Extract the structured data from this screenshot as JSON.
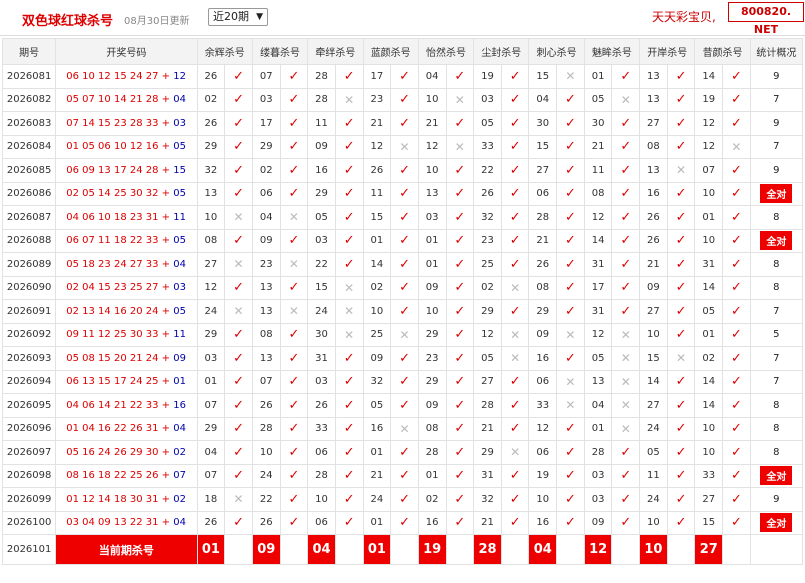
{
  "header": {
    "title": "双色球红球杀号",
    "date": "08月30日更新",
    "period_select": "近20期",
    "brand": "天天彩宝贝,",
    "site": "800820. NET"
  },
  "columns": [
    "期号",
    "开奖号码",
    "余辉杀号",
    "缕暮杀号",
    "牵绊杀号",
    "蓝颜杀号",
    "怡然杀号",
    "尘封杀号",
    "刺心杀号",
    "魅眸杀号",
    "开岸杀号",
    "昔颜杀号",
    "统计概况"
  ],
  "rows": [
    {
      "issue": "2026081",
      "red": "06 10 12 15 24 27",
      "blue": "12",
      "kills": [
        [
          "26",
          true
        ],
        [
          "07",
          true
        ],
        [
          "28",
          true
        ],
        [
          "17",
          true
        ],
        [
          "04",
          true
        ],
        [
          "19",
          true
        ],
        [
          "15",
          false
        ],
        [
          "01",
          true
        ],
        [
          "13",
          true
        ],
        [
          "14",
          true
        ]
      ],
      "count": "9"
    },
    {
      "issue": "2026082",
      "red": "05 07 10 14 21 28",
      "blue": "04",
      "kills": [
        [
          "02",
          true
        ],
        [
          "03",
          true
        ],
        [
          "28",
          false
        ],
        [
          "23",
          true
        ],
        [
          "10",
          false
        ],
        [
          "03",
          true
        ],
        [
          "04",
          true
        ],
        [
          "05",
          false
        ],
        [
          "13",
          true
        ],
        [
          "19",
          true
        ]
      ],
      "count": "7"
    },
    {
      "issue": "2026083",
      "red": "07 14 15 23 28 33",
      "blue": "03",
      "kills": [
        [
          "26",
          true
        ],
        [
          "17",
          true
        ],
        [
          "11",
          true
        ],
        [
          "21",
          true
        ],
        [
          "21",
          true
        ],
        [
          "05",
          true
        ],
        [
          "30",
          true
        ],
        [
          "30",
          true
        ],
        [
          "27",
          true
        ],
        [
          "12",
          true
        ]
      ],
      "count": "9"
    },
    {
      "issue": "2026084",
      "red": "01 05 06 10 12 16",
      "blue": "05",
      "kills": [
        [
          "29",
          true
        ],
        [
          "29",
          true
        ],
        [
          "09",
          true
        ],
        [
          "12",
          false
        ],
        [
          "12",
          false
        ],
        [
          "33",
          true
        ],
        [
          "15",
          true
        ],
        [
          "21",
          true
        ],
        [
          "08",
          true
        ],
        [
          "12",
          false
        ]
      ],
      "count": "7"
    },
    {
      "issue": "2026085",
      "red": "06 09 13 17 24 28",
      "blue": "15",
      "kills": [
        [
          "32",
          true
        ],
        [
          "02",
          true
        ],
        [
          "16",
          true
        ],
        [
          "26",
          true
        ],
        [
          "10",
          true
        ],
        [
          "22",
          true
        ],
        [
          "27",
          true
        ],
        [
          "11",
          true
        ],
        [
          "13",
          false
        ],
        [
          "07",
          true
        ]
      ],
      "count": "9"
    },
    {
      "issue": "2026086",
      "red": "02 05 14 25 30 32",
      "blue": "05",
      "kills": [
        [
          "13",
          true
        ],
        [
          "06",
          true
        ],
        [
          "29",
          true
        ],
        [
          "11",
          true
        ],
        [
          "13",
          true
        ],
        [
          "26",
          true
        ],
        [
          "06",
          true
        ],
        [
          "08",
          true
        ],
        [
          "16",
          true
        ],
        [
          "10",
          true
        ]
      ],
      "count": "全对",
      "all": true
    },
    {
      "issue": "2026087",
      "red": "04 06 10 18 23 31",
      "blue": "11",
      "kills": [
        [
          "10",
          false
        ],
        [
          "04",
          false
        ],
        [
          "05",
          true
        ],
        [
          "15",
          true
        ],
        [
          "03",
          true
        ],
        [
          "32",
          true
        ],
        [
          "28",
          true
        ],
        [
          "12",
          true
        ],
        [
          "26",
          true
        ],
        [
          "01",
          true
        ]
      ],
      "count": "8"
    },
    {
      "issue": "2026088",
      "red": "06 07 11 18 22 33",
      "blue": "05",
      "kills": [
        [
          "08",
          true
        ],
        [
          "09",
          true
        ],
        [
          "03",
          true
        ],
        [
          "01",
          true
        ],
        [
          "01",
          true
        ],
        [
          "23",
          true
        ],
        [
          "21",
          true
        ],
        [
          "14",
          true
        ],
        [
          "26",
          true
        ],
        [
          "10",
          true
        ]
      ],
      "count": "全对",
      "all": true
    },
    {
      "issue": "2026089",
      "red": "05 18 23 24 27 33",
      "blue": "04",
      "kills": [
        [
          "27",
          false
        ],
        [
          "23",
          false
        ],
        [
          "22",
          true
        ],
        [
          "14",
          true
        ],
        [
          "01",
          true
        ],
        [
          "25",
          true
        ],
        [
          "26",
          true
        ],
        [
          "31",
          true
        ],
        [
          "21",
          true
        ],
        [
          "31",
          true
        ]
      ],
      "count": "8"
    },
    {
      "issue": "2026090",
      "red": "02 04 15 23 25 27",
      "blue": "03",
      "kills": [
        [
          "12",
          true
        ],
        [
          "13",
          true
        ],
        [
          "15",
          false
        ],
        [
          "02",
          true
        ],
        [
          "09",
          true
        ],
        [
          "02",
          false
        ],
        [
          "08",
          true
        ],
        [
          "17",
          true
        ],
        [
          "09",
          true
        ],
        [
          "14",
          true
        ]
      ],
      "count": "8"
    },
    {
      "issue": "2026091",
      "red": "02 13 14 16 20 24",
      "blue": "05",
      "kills": [
        [
          "24",
          false
        ],
        [
          "13",
          false
        ],
        [
          "24",
          false
        ],
        [
          "10",
          true
        ],
        [
          "10",
          true
        ],
        [
          "29",
          true
        ],
        [
          "29",
          true
        ],
        [
          "31",
          true
        ],
        [
          "27",
          true
        ],
        [
          "05",
          true
        ]
      ],
      "count": "7"
    },
    {
      "issue": "2026092",
      "red": "09 11 12 25 30 33",
      "blue": "11",
      "kills": [
        [
          "29",
          true
        ],
        [
          "08",
          true
        ],
        [
          "30",
          false
        ],
        [
          "25",
          false
        ],
        [
          "29",
          true
        ],
        [
          "12",
          false
        ],
        [
          "09",
          false
        ],
        [
          "12",
          false
        ],
        [
          "10",
          true
        ],
        [
          "01",
          true
        ]
      ],
      "count": "5"
    },
    {
      "issue": "2026093",
      "red": "05 08 15 20 21 24",
      "blue": "09",
      "kills": [
        [
          "03",
          true
        ],
        [
          "13",
          true
        ],
        [
          "31",
          true
        ],
        [
          "09",
          true
        ],
        [
          "23",
          true
        ],
        [
          "05",
          false
        ],
        [
          "16",
          true
        ],
        [
          "05",
          false
        ],
        [
          "15",
          false
        ],
        [
          "02",
          true
        ]
      ],
      "count": "7"
    },
    {
      "issue": "2026094",
      "red": "06 13 15 17 24 25",
      "blue": "01",
      "kills": [
        [
          "01",
          true
        ],
        [
          "07",
          true
        ],
        [
          "03",
          true
        ],
        [
          "32",
          true
        ],
        [
          "29",
          true
        ],
        [
          "27",
          true
        ],
        [
          "06",
          false
        ],
        [
          "13",
          false
        ],
        [
          "14",
          true
        ],
        [
          "14",
          true
        ]
      ],
      "count": "7"
    },
    {
      "issue": "2026095",
      "red": "04 06 14 21 22 33",
      "blue": "16",
      "kills": [
        [
          "07",
          true
        ],
        [
          "26",
          true
        ],
        [
          "26",
          true
        ],
        [
          "05",
          true
        ],
        [
          "09",
          true
        ],
        [
          "28",
          true
        ],
        [
          "33",
          false
        ],
        [
          "04",
          false
        ],
        [
          "27",
          true
        ],
        [
          "14",
          true
        ]
      ],
      "count": "8"
    },
    {
      "issue": "2026096",
      "red": "01 04 16 22 26 31",
      "blue": "04",
      "kills": [
        [
          "29",
          true
        ],
        [
          "28",
          true
        ],
        [
          "33",
          true
        ],
        [
          "16",
          false
        ],
        [
          "08",
          true
        ],
        [
          "21",
          true
        ],
        [
          "12",
          true
        ],
        [
          "01",
          false
        ],
        [
          "24",
          true
        ],
        [
          "10",
          true
        ]
      ],
      "count": "8"
    },
    {
      "issue": "2026097",
      "red": "05 16 24 26 29 30",
      "blue": "02",
      "kills": [
        [
          "04",
          true
        ],
        [
          "10",
          true
        ],
        [
          "06",
          true
        ],
        [
          "01",
          true
        ],
        [
          "28",
          true
        ],
        [
          "29",
          false
        ],
        [
          "06",
          true
        ],
        [
          "28",
          true
        ],
        [
          "05",
          true
        ],
        [
          "10",
          true
        ]
      ],
      "count": "8"
    },
    {
      "issue": "2026098",
      "red": "08 16 18 22 25 26",
      "blue": "07",
      "kills": [
        [
          "07",
          true
        ],
        [
          "24",
          true
        ],
        [
          "28",
          true
        ],
        [
          "21",
          true
        ],
        [
          "01",
          true
        ],
        [
          "31",
          true
        ],
        [
          "19",
          true
        ],
        [
          "03",
          true
        ],
        [
          "11",
          true
        ],
        [
          "33",
          true
        ]
      ],
      "count": "全对",
      "all": true
    },
    {
      "issue": "2026099",
      "red": "01 12 14 18 30 31",
      "blue": "02",
      "kills": [
        [
          "18",
          false
        ],
        [
          "22",
          true
        ],
        [
          "10",
          true
        ],
        [
          "24",
          true
        ],
        [
          "02",
          true
        ],
        [
          "32",
          true
        ],
        [
          "10",
          true
        ],
        [
          "03",
          true
        ],
        [
          "24",
          true
        ],
        [
          "27",
          true
        ]
      ],
      "count": "9"
    },
    {
      "issue": "2026100",
      "red": "03 04 09 13 22 31",
      "blue": "04",
      "kills": [
        [
          "26",
          true
        ],
        [
          "26",
          true
        ],
        [
          "06",
          true
        ],
        [
          "01",
          true
        ],
        [
          "16",
          true
        ],
        [
          "21",
          true
        ],
        [
          "16",
          true
        ],
        [
          "09",
          true
        ],
        [
          "10",
          true
        ],
        [
          "15",
          true
        ]
      ],
      "count": "全对",
      "all": true
    }
  ],
  "current": {
    "issue": "2026101",
    "label": "当前期杀号",
    "picks": [
      "01",
      "09",
      "04",
      "01",
      "19",
      "28",
      "04",
      "12",
      "10",
      "27"
    ]
  },
  "marks": {
    "ok": "✓",
    "no": "✕"
  },
  "colors": {
    "accent": "#dd0000",
    "blue_ball": "#0000aa",
    "header_bg": "#f3f3f3"
  }
}
